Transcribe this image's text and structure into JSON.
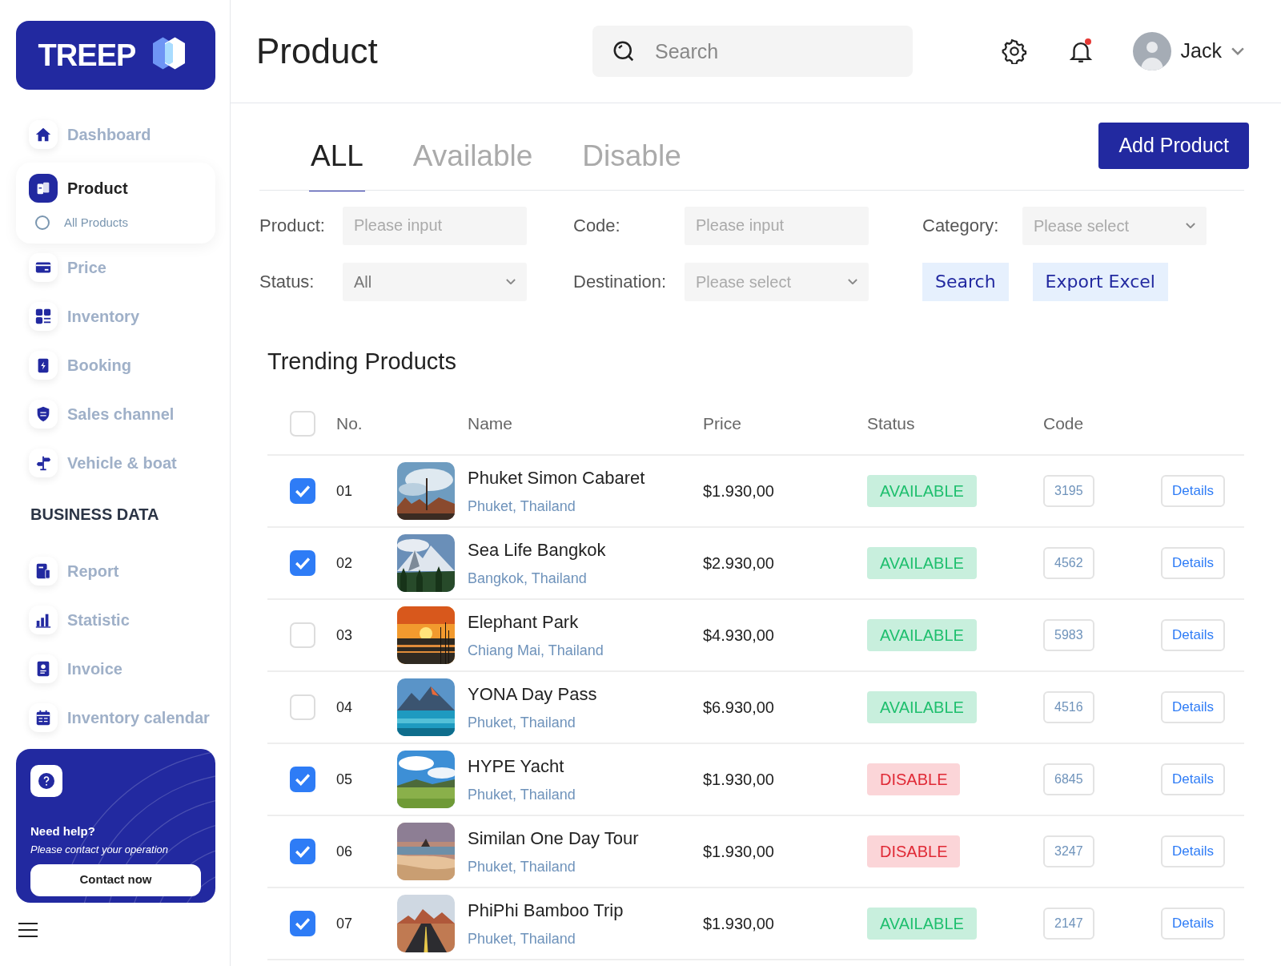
{
  "sidebar": {
    "logo": "TREEP",
    "items": [
      {
        "label": "Dashboard",
        "selected": false
      },
      {
        "label": "Product",
        "selected": true,
        "children": [
          {
            "label": "All Products",
            "selected": false
          }
        ]
      },
      {
        "label": "Price",
        "selected": false
      },
      {
        "label": "Inventory",
        "selected": false
      },
      {
        "label": "Booking",
        "selected": false
      },
      {
        "label": "Sales channel",
        "selected": false
      },
      {
        "label": "Vehicle & boat",
        "selected": false
      }
    ],
    "section_title": "BUSINESS DATA",
    "section_items": [
      {
        "label": "Report",
        "selected": false
      },
      {
        "label": "Statistic",
        "selected": false
      },
      {
        "label": "Invoice",
        "selected": false
      },
      {
        "label": "Inventory calendar",
        "selected": false
      }
    ],
    "help": {
      "title": "Need help?",
      "text": "Please contact your operation",
      "button": "Contact now"
    }
  },
  "header": {
    "title": "Product",
    "search": {
      "placeholder": "Search"
    },
    "notification": true,
    "user": "Jack"
  },
  "tabs": [
    {
      "label": "ALL",
      "selected": true
    },
    {
      "label": "Available",
      "selected": false
    },
    {
      "label": "Disable",
      "selected": false
    }
  ],
  "add_button": "Add Product",
  "filters": {
    "product": {
      "label": "Product:",
      "placeholder": "Please input"
    },
    "code": {
      "label": "Code:",
      "placeholder": "Please input"
    },
    "category": {
      "label": "Category:",
      "placeholder": "Please select"
    },
    "status": {
      "label": "Status:",
      "value": "All"
    },
    "destination": {
      "label": "Destination:",
      "placeholder": "Please select"
    },
    "search_button": "Search",
    "export_button": "Export Excel"
  },
  "table": {
    "title": "Trending Products",
    "select_all": false,
    "columns": [
      "No.",
      "Name",
      "Price",
      "Status",
      "Code"
    ],
    "rows": [
      {
        "checked": true,
        "no": "01",
        "name": "Phuket Simon Cabaret",
        "location": "Phuket, Thailand",
        "price": "$1.930,00",
        "status": "AVAILABLE",
        "kind": "available",
        "code": "3195",
        "action": "Details"
      },
      {
        "checked": true,
        "no": "02",
        "name": "Sea Life Bangkok",
        "location": "Bangkok, Thailand",
        "price": "$2.930,00",
        "status": "AVAILABLE",
        "kind": "available",
        "code": "4562",
        "action": "Details"
      },
      {
        "checked": false,
        "no": "03",
        "name": "Elephant Park",
        "location": "Chiang Mai, Thailand",
        "price": "$4.930,00",
        "status": "AVAILABLE",
        "kind": "available",
        "code": "5983",
        "action": "Details"
      },
      {
        "checked": false,
        "no": "04",
        "name": "YONA Day Pass",
        "location": "Phuket, Thailand",
        "price": "$6.930,00",
        "status": "AVAILABLE",
        "kind": "available",
        "code": "4516",
        "action": "Details"
      },
      {
        "checked": true,
        "no": "05",
        "name": "HYPE Yacht",
        "location": "Phuket, Thailand",
        "price": "$1.930,00",
        "status": "DISABLE",
        "kind": "disable",
        "code": "6845",
        "action": "Details"
      },
      {
        "checked": true,
        "no": "06",
        "name": "Similan One Day Tour",
        "location": "Phuket, Thailand",
        "price": "$1.930,00",
        "status": "DISABLE",
        "kind": "disable",
        "code": "3247",
        "action": "Details"
      },
      {
        "checked": true,
        "no": "07",
        "name": "PhiPhi Bamboo Trip",
        "location": "Phuket, Thailand",
        "price": "$1.930,00",
        "status": "AVAILABLE",
        "kind": "available",
        "code": "2147",
        "action": "Details"
      }
    ]
  }
}
